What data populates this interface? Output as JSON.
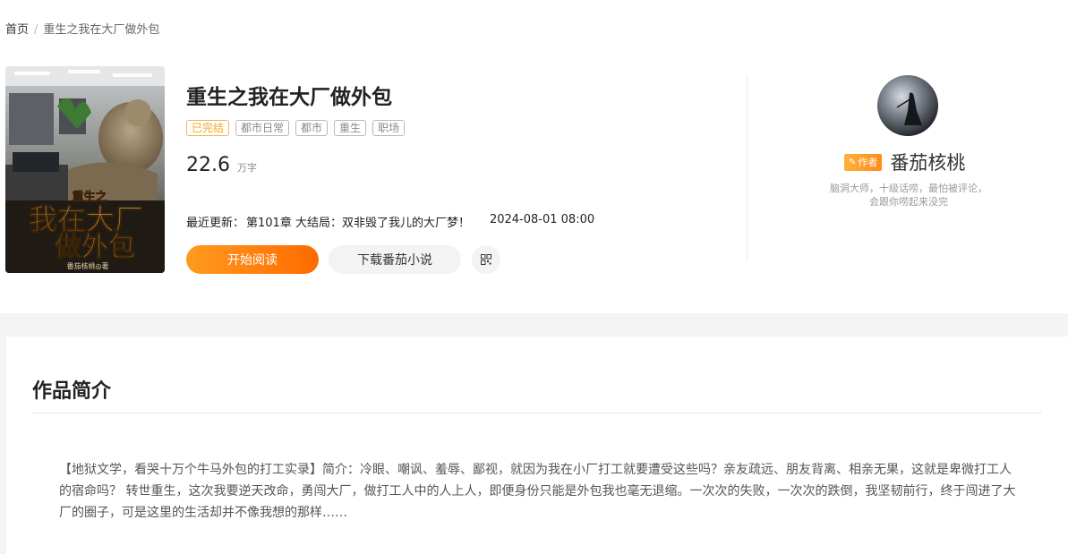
{
  "breadcrumb": {
    "home": "首页",
    "separator": "/",
    "current": "重生之我在大厂做外包"
  },
  "cover": {
    "top_text": "重生之",
    "main_line1": "我在大厂",
    "main_line2": "做外包",
    "author_sign": "番茄核桃◎著"
  },
  "book": {
    "title": "重生之我在大厂做外包",
    "tags": [
      "已完结",
      "都市日常",
      "都市",
      "重生",
      "职场"
    ],
    "word_count": "22.6",
    "word_unit": "万字",
    "update_label": "最近更新：",
    "update_chapter": "第101章 大结局：双非毁了我儿的大厂梦！",
    "update_time": "2024-08-01 08:00"
  },
  "actions": {
    "read_label": "开始阅读",
    "download_label": "下载番茄小说",
    "qr_icon": "qrcode-icon"
  },
  "author": {
    "badge": "作者",
    "name": "番茄核桃",
    "desc": "脑洞大师，十级话唠，最怕被评论，会跟你唠起来没完"
  },
  "intro_section": {
    "title": "作品简介",
    "text": "【地狱文学，看哭十万个牛马外包的打工实录】简介：冷眼、嘲讽、羞辱、鄙视，就因为我在小厂打工就要遭受这些吗？亲友疏远、朋友背离、相亲无果，这就是卑微打工人的宿命吗？ 转世重生，这次我要逆天改命，勇闯大厂，做打工人中的人上人，即便身份只能是外包我也毫无退缩。一次次的失败，一次次的跌倒，我坚韧前行，终于闯进了大厂的圈子，可是这里的生活却并不像我想的那样……"
  },
  "colors": {
    "accent": "#ff7a0f",
    "tag_done": "#f5a623"
  }
}
